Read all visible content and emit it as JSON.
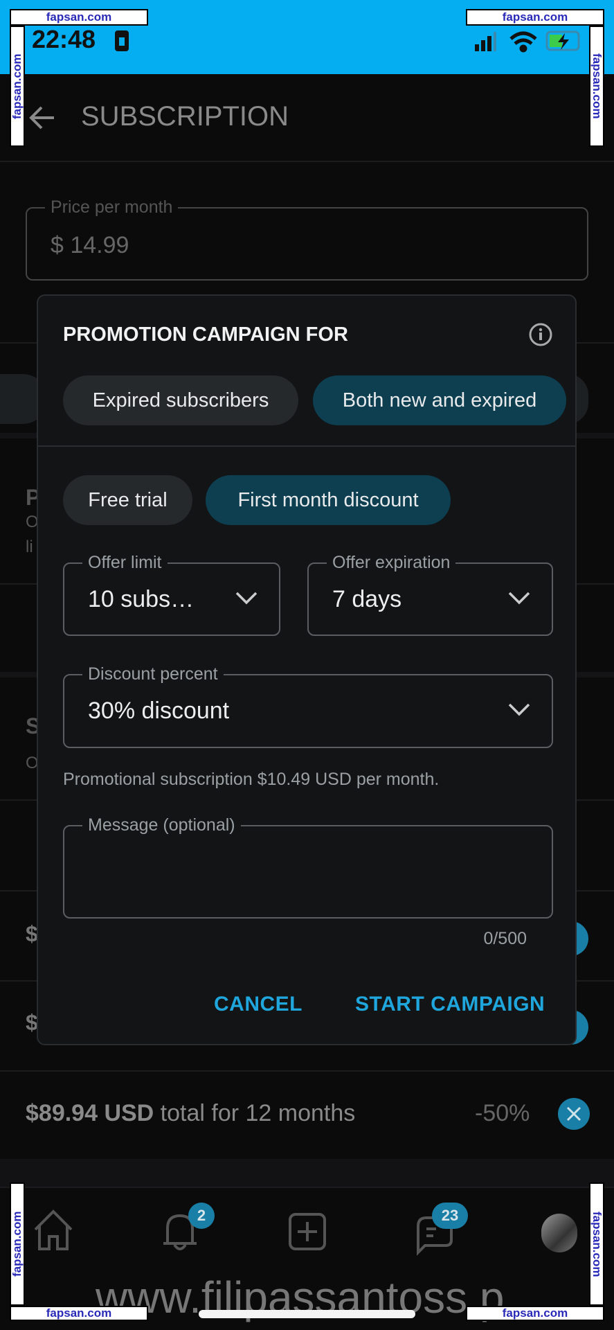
{
  "status_bar": {
    "time": "22:48"
  },
  "watermark": {
    "site": "fapsan.com",
    "overlay": "www.filipassantoss.p"
  },
  "header": {
    "title": "SUBSCRIPTION"
  },
  "price_field": {
    "label": "Price per month",
    "value": "$ 14.99"
  },
  "background_fragments": {
    "a": "P",
    "b": "O",
    "c": "li",
    "d": "S",
    "e": "O",
    "f": "$",
    "g": "$"
  },
  "bundle_row": {
    "total": "$89.94 USD",
    "suffix": " total for 12 months",
    "discount": "-50%"
  },
  "modal": {
    "title": "PROMOTION CAMPAIGN FOR",
    "audience_chips": [
      {
        "label": "Expired subscribers",
        "selected": false
      },
      {
        "label": "Both new and expired",
        "selected": true
      }
    ],
    "type_chips": [
      {
        "label": "Free trial",
        "selected": false
      },
      {
        "label": "First month discount",
        "selected": true
      }
    ],
    "offer_limit": {
      "label": "Offer limit",
      "value": "10 subs…"
    },
    "offer_expiration": {
      "label": "Offer expiration",
      "value": "7 days"
    },
    "discount_percent": {
      "label": "Discount percent",
      "value": "30% discount"
    },
    "promo_text": "Promotional subscription $10.49 USD per month.",
    "message": {
      "label": "Message (optional)",
      "value": "",
      "counter": "0/500"
    },
    "cancel": "CANCEL",
    "start": "START CAMPAIGN"
  },
  "nav": {
    "notifications_badge": "2",
    "messages_badge": "23"
  },
  "colors": {
    "accent": "#1fa6dc",
    "chip_selected": "#0d3f51",
    "status_bar": "#05aef0"
  }
}
